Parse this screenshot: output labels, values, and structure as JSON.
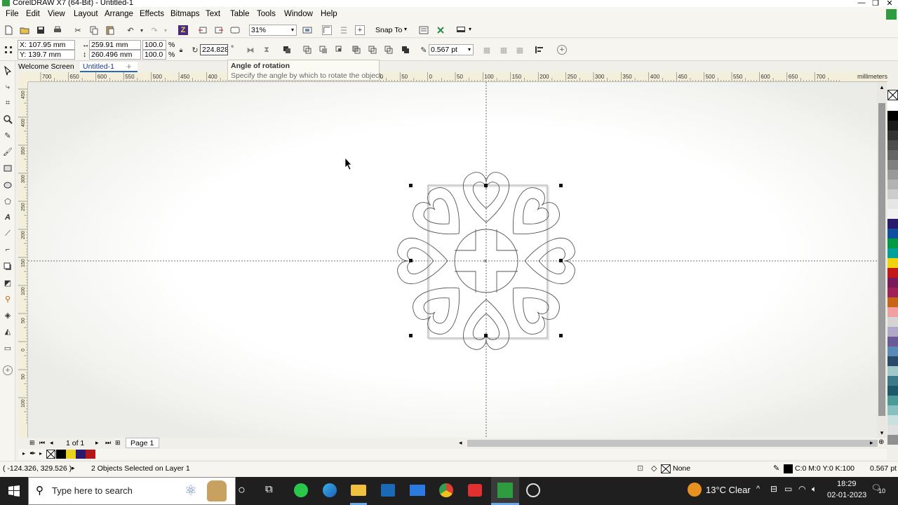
{
  "app": {
    "title": "CorelDRAW X7 (64-Bit) - Untitled-1"
  },
  "window_controls": {
    "minimize": "—",
    "maximize": "❐",
    "close": "✕"
  },
  "menu": [
    "File",
    "Edit",
    "View",
    "Layout",
    "Arrange",
    "Effects",
    "Bitmaps",
    "Text",
    "Table",
    "Tools",
    "Window",
    "Help"
  ],
  "toolbar": {
    "zoom": "31%",
    "snap_to": "Snap To"
  },
  "property_bar": {
    "x": "X: 107.95 mm",
    "y": "Y: 139.7 mm",
    "width": "259.91 mm",
    "height": "260.496 mm",
    "scale_w": "100.0",
    "scale_h": "100.0",
    "percent": "%",
    "angle": "224.828",
    "degree": "°",
    "outline_width": "0.567 pt"
  },
  "tooltip": {
    "title": "Angle of rotation",
    "body": "Specify the angle by which to rotate the object."
  },
  "tabs": [
    {
      "label": "Welcome Screen"
    },
    {
      "label": "Untitled-1"
    }
  ],
  "tab_add": "+",
  "rulers": {
    "unit": "millimeters",
    "h_ticks": [
      "700",
      "650",
      "600",
      "550",
      "500",
      "450",
      "400",
      "350",
      "300",
      "250",
      "200",
      "150",
      "100",
      "50",
      "0",
      "50",
      "100",
      "150",
      "200",
      "250",
      "300",
      "350",
      "400",
      "450",
      "500",
      "550",
      "600",
      "650",
      "700"
    ],
    "v_ticks": [
      "450",
      "400",
      "350",
      "300",
      "250",
      "200",
      "150",
      "100",
      "50",
      "0",
      "50",
      "100"
    ]
  },
  "page_nav": {
    "page_count": "1 of 1",
    "page_tab": "Page 1"
  },
  "status": {
    "coords": "( -124.326, 329.526 )",
    "selection": "2 Objects Selected on Layer 1",
    "fill": "None",
    "outline_color": "C:0 M:0 Y:0 K:100",
    "outline_width": "0.567 pt"
  },
  "taskbar": {
    "search_placeholder": "Type here to search",
    "weather": "13°C  Clear",
    "time": "18:29",
    "date": "02-01-2023",
    "notifications": "10"
  },
  "palette_colors": [
    "#ffffff",
    "#000000",
    "#1a1a1a",
    "#333333",
    "#4d4d4d",
    "#666666",
    "#808080",
    "#999999",
    "#b3b3b3",
    "#cccccc",
    "#e6e6e6",
    "#f2f2f2",
    "#2a1a6e",
    "#0f4fa0",
    "#009a44",
    "#00a19a",
    "#f2d20a",
    "#c21818",
    "#7a1a5a",
    "#a0205a",
    "#c86414",
    "#f0a0a0",
    "#d4d4d4",
    "#b0a8c8",
    "#6a5a9a",
    "#5a8ab8",
    "#2a4a6a",
    "#a0c8c8",
    "#3a7a8a",
    "#1a5a6a",
    "#4a9a9a",
    "#88c0c0",
    "#c8e0e0",
    "#e0e0e0",
    "#909090"
  ],
  "docked_palette": [
    "#000000",
    "#e8d21a",
    "#2a1a6e",
    "#b21818"
  ]
}
